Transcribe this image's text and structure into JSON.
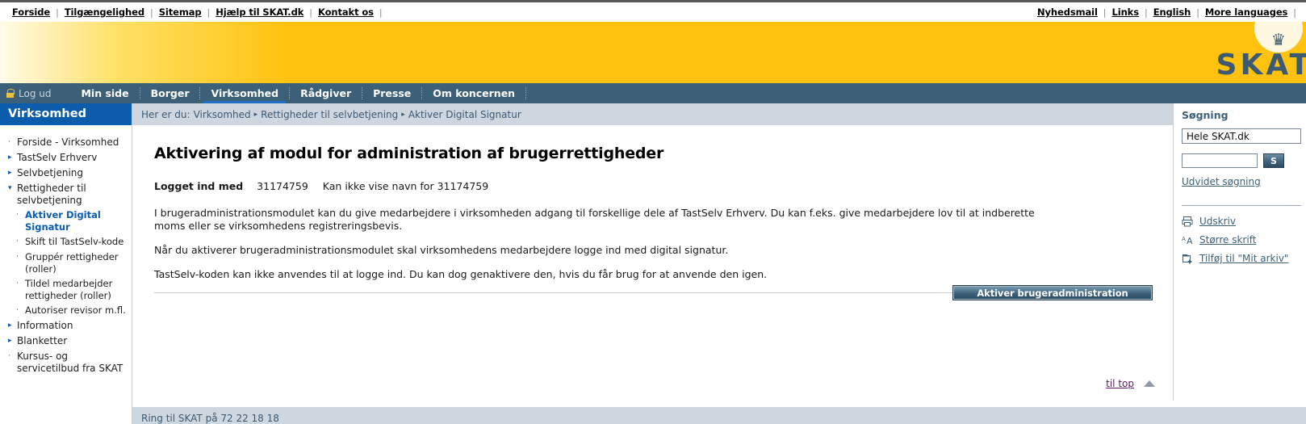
{
  "topbar": {
    "left_links": [
      "Forside",
      "Tilgængelighed",
      "Sitemap",
      "Hjælp til SKAT.dk",
      "Kontakt os"
    ],
    "right_links": [
      "Nyhedsmail",
      "Links",
      "English",
      "More languages"
    ],
    "separator": "|"
  },
  "banner": {
    "logo_text": "SKAT",
    "crown_glyph": "♛"
  },
  "mainnav": {
    "logout_label": "Log ud",
    "items": [
      {
        "label": "Min side",
        "active": false
      },
      {
        "label": "Borger",
        "active": false
      },
      {
        "label": "Virksomhed",
        "active": true
      },
      {
        "label": "Rådgiver",
        "active": false
      },
      {
        "label": "Presse",
        "active": false
      },
      {
        "label": "Om koncernen",
        "active": false
      }
    ]
  },
  "sidebar": {
    "title": "Virksomhed",
    "items": [
      {
        "label": "Forside - Virksomhed",
        "marker": "·",
        "level": 1,
        "current": false
      },
      {
        "label": "TastSelv Erhverv",
        "marker": "▸",
        "level": 1,
        "current": false
      },
      {
        "label": "Selvbetjening",
        "marker": "▸",
        "level": 1,
        "current": false
      },
      {
        "label": "Rettigheder til selvbetjening",
        "marker": "▾",
        "level": 1,
        "current": false
      },
      {
        "label": "Aktiver Digital Signatur",
        "marker": "·",
        "level": 2,
        "current": true
      },
      {
        "label": "Skift til TastSelv-kode",
        "marker": "·",
        "level": 2,
        "current": false
      },
      {
        "label": "Gruppér rettigheder (roller)",
        "marker": "·",
        "level": 2,
        "current": false
      },
      {
        "label": "Tildel medarbejder rettigheder (roller)",
        "marker": "·",
        "level": 2,
        "current": false
      },
      {
        "label": "Autoriser revisor m.fl.",
        "marker": "·",
        "level": 2,
        "current": false
      },
      {
        "label": "Information",
        "marker": "▸",
        "level": 1,
        "current": false
      },
      {
        "label": "Blanketter",
        "marker": "▸",
        "level": 1,
        "current": false
      },
      {
        "label": "Kursus- og servicetilbud fra SKAT",
        "marker": "·",
        "level": 1,
        "current": false
      }
    ]
  },
  "breadcrumb": {
    "prefix": "Her er du:",
    "items": [
      "Virksomhed",
      "Rettigheder til selvbetjening",
      "Aktiver Digital Signatur"
    ],
    "separator": "▸"
  },
  "main": {
    "title": "Aktivering af modul for administration af brugerrettigheder",
    "logged_in_label": "Logget ind med",
    "logged_in_cvr": "31174759",
    "logged_in_note": "Kan ikke vise navn for 31174759",
    "paragraphs": [
      "I brugeradministrationsmodulet kan du give medarbejdere i virksomheden adgang til forskellige dele af TastSelv Erhverv. Du kan f.eks. give medarbejdere lov til at indberette moms eller se virksomhedens registreringsbevis.",
      "Når du aktiverer brugeradministrationsmodulet skal virksomhedens medarbejdere logge ind med digital signatur.",
      "TastSelv-koden kan ikke anvendes til at logge ind. Du kan dog genaktivere den, hvis du får brug for at anvende den igen."
    ],
    "action_button": "Aktiver brugeradministration",
    "to_top_label": "til top"
  },
  "search": {
    "title": "Søgning",
    "scope_selected": "Hele SKAT.dk",
    "input_value": "",
    "input_placeholder": "",
    "submit_label": "S",
    "advanced_label": "Udvidet søgning"
  },
  "tools": [
    {
      "label": "Udskriv",
      "icon": "printer-icon"
    },
    {
      "label": "Større skrift",
      "icon": "larger-text-icon"
    },
    {
      "label": "Tilføj til \"Mit arkiv\"",
      "icon": "add-to-archive-icon"
    }
  ],
  "footer": {
    "phone_text": "Ring til SKAT på 72 22 18 18"
  },
  "colors": {
    "brand_yellow": "#ffc20e",
    "nav_blue": "#3d6079",
    "sidebar_blue": "#0b5cab",
    "breadcrumb_bg": "#ced6e0",
    "link_visited": "#5c1a5c"
  }
}
